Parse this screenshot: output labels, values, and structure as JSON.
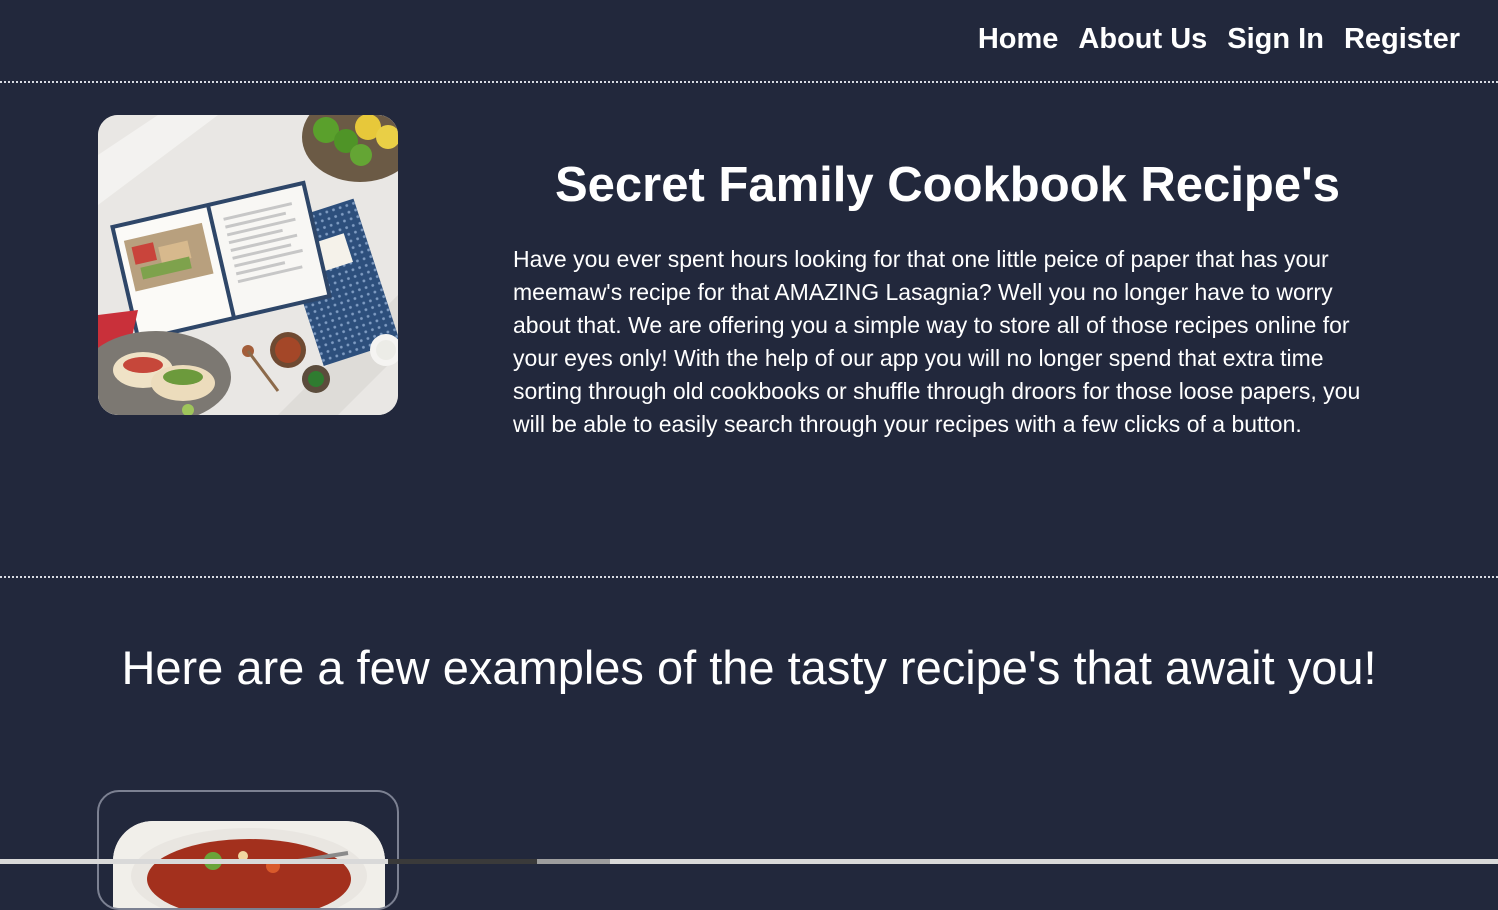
{
  "nav": {
    "items": [
      {
        "label": "Home"
      },
      {
        "label": "About Us"
      },
      {
        "label": "Sign In"
      },
      {
        "label": "Register"
      }
    ]
  },
  "hero": {
    "title": "Secret Family Cookbook Recipe's",
    "description": "Have you ever spent hours looking for that one little peice of paper that has your meemaw's recipe for that AMAZING Lasagnia? Well you no longer have to worry about that. We are offering you a simple way to store all of those recipes online for your eyes only! With the help of our app you will no longer spend that extra time sorting through old cookbooks or shuffle through droors for those loose papers, you will be able to easily search through your recipes with a few clicks of a button.",
    "image_icon": "cookbook-photo"
  },
  "examples": {
    "title": "Here are a few examples of the tasty recipe's that await you!",
    "card_image_icon": "soup-bowl-photo"
  },
  "colors": {
    "background": "#22283c",
    "text": "#ffffff",
    "divider": "#d8dbe3"
  }
}
